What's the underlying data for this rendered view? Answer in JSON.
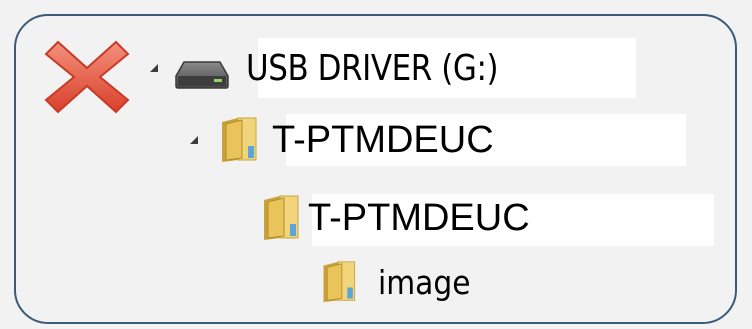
{
  "tree": {
    "status_icon": "red-x-icon",
    "drive": {
      "label": "USB DRIVER (G:)",
      "icon": "usb-drive-icon",
      "expanded": true
    },
    "folders": [
      {
        "label": "T-PTMDEUC",
        "icon": "folder-icon",
        "expanded": true,
        "level": 1
      },
      {
        "label": "T-PTMDEUC",
        "icon": "folder-icon",
        "expanded": false,
        "level": 2
      },
      {
        "label": "image",
        "icon": "folder-icon",
        "expanded": false,
        "level": 3
      }
    ]
  },
  "colors": {
    "frame_border": "#3b5a78",
    "x_mark": "#e8604a",
    "folder": "#e6c25a"
  }
}
